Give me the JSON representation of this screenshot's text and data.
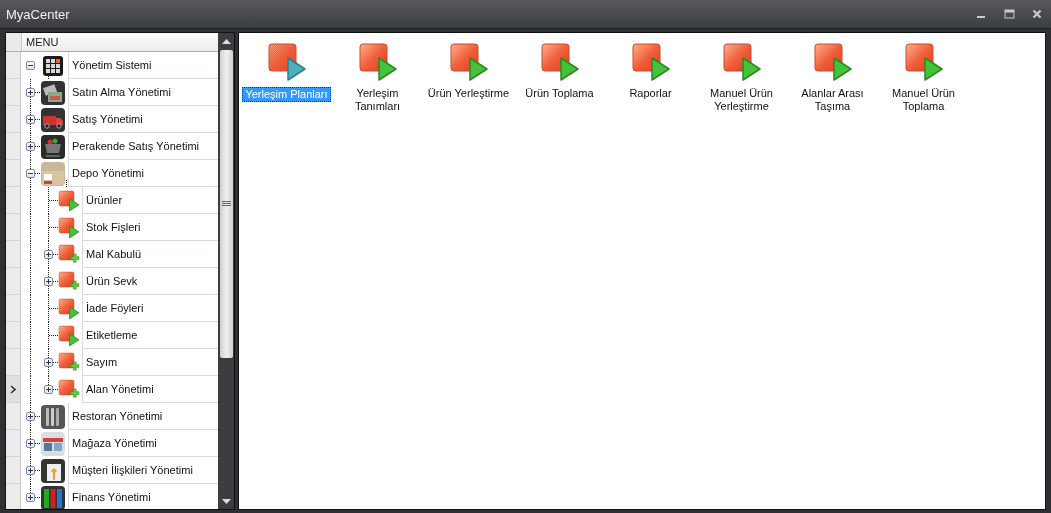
{
  "window": {
    "title": "MyaCenter"
  },
  "menu": {
    "header": "MENU",
    "tree": [
      {
        "label": "Yönetim Sistemi",
        "kind": "module",
        "expanded": true,
        "current": false,
        "children": [
          {
            "label": "Satın Alma Yönetimi",
            "kind": "module",
            "expanded": false,
            "current": false
          },
          {
            "label": "Satış Yönetimi",
            "kind": "module",
            "expanded": false,
            "current": false
          },
          {
            "label": "Perakende Satış Yönetimi",
            "kind": "module",
            "expanded": false,
            "current": false
          },
          {
            "label": "Depo Yönetimi",
            "kind": "module",
            "expanded": true,
            "current": false,
            "children": [
              {
                "label": "Ürünler",
                "kind": "form",
                "current": false
              },
              {
                "label": "Stok Fişleri",
                "kind": "form",
                "current": false
              },
              {
                "label": "Mal Kabulü",
                "kind": "folder",
                "expanded": false,
                "current": false
              },
              {
                "label": "Ürün Sevk",
                "kind": "folder",
                "expanded": false,
                "current": false
              },
              {
                "label": "İade Föyleri",
                "kind": "form",
                "current": false
              },
              {
                "label": "Etiketleme",
                "kind": "form",
                "current": false
              },
              {
                "label": "Sayım",
                "kind": "folder",
                "expanded": false,
                "current": false
              },
              {
                "label": "Alan Yönetimi",
                "kind": "folder",
                "expanded": false,
                "current": true
              }
            ]
          },
          {
            "label": "Restoran Yönetimi",
            "kind": "module",
            "expanded": false,
            "current": false
          },
          {
            "label": "Mağaza Yönetimi",
            "kind": "module",
            "expanded": false,
            "current": false
          },
          {
            "label": "Müşteri İlişkileri Yönetimi",
            "kind": "module",
            "expanded": false,
            "current": false
          },
          {
            "label": "Finans Yönetimi",
            "kind": "module",
            "expanded": false,
            "current": false
          }
        ]
      }
    ]
  },
  "items": [
    {
      "label": "Yerleşim Planları",
      "selected": true
    },
    {
      "label": "Yerleşim Tanımları",
      "selected": false
    },
    {
      "label": "Ürün Yerleştirme",
      "selected": false
    },
    {
      "label": "Ürün Toplama",
      "selected": false
    },
    {
      "label": "Raporlar",
      "selected": false
    },
    {
      "label": "Manuel Ürün Yerleştirme",
      "selected": false
    },
    {
      "label": "Alanlar Arası Taşıma",
      "selected": false
    },
    {
      "label": "Manuel Ürün Toplama",
      "selected": false
    }
  ]
}
